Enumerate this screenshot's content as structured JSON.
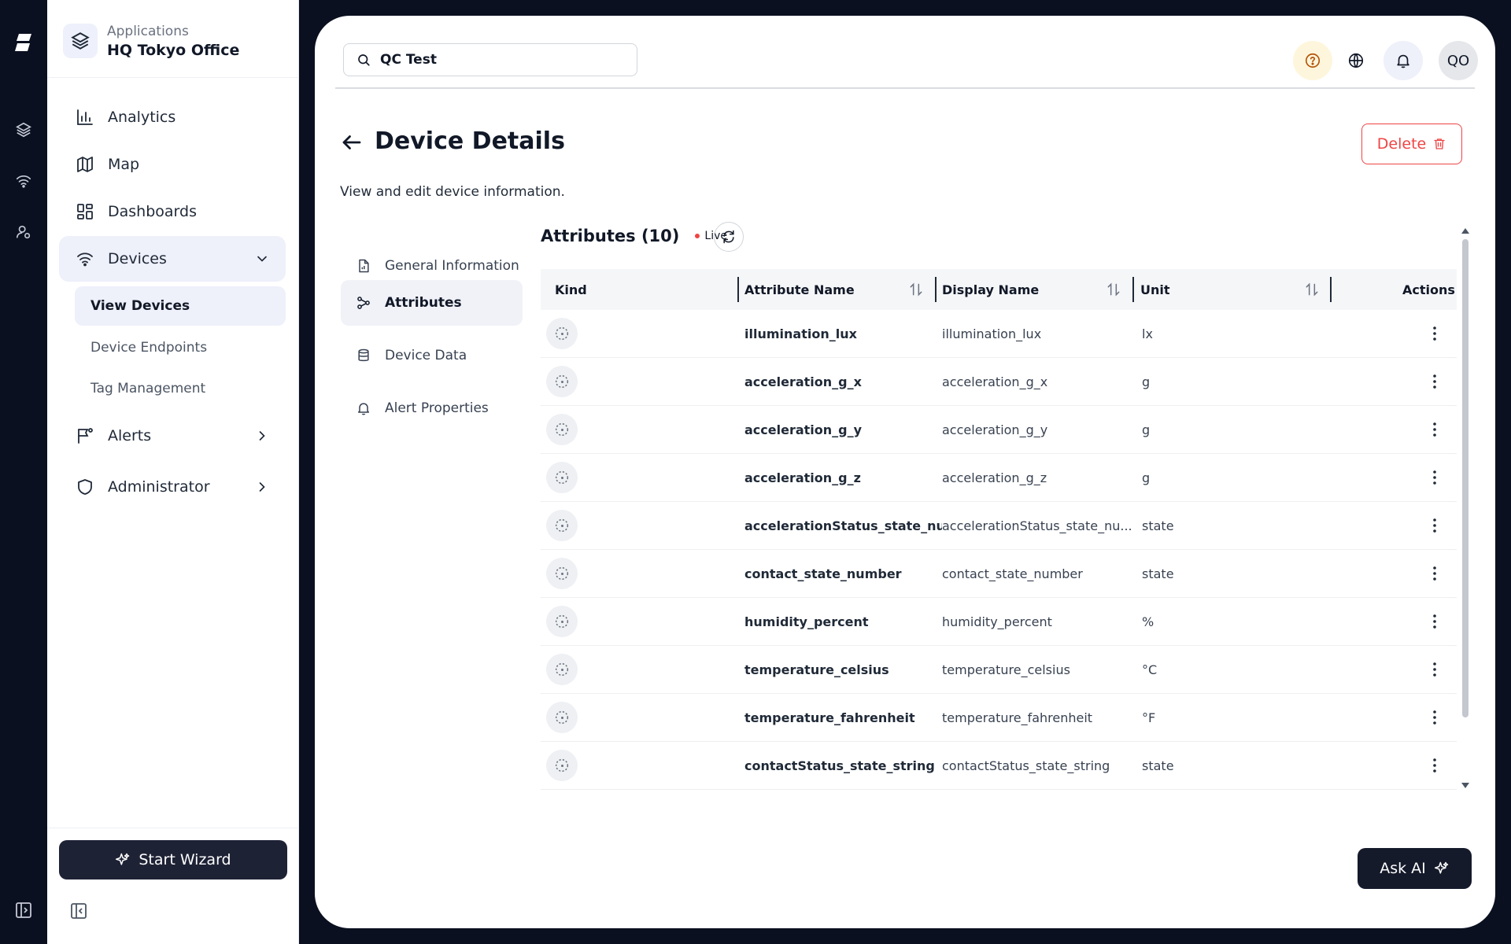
{
  "app": {
    "section_label": "Applications",
    "name": "HQ Tokyo Office"
  },
  "sidebar": {
    "items": [
      {
        "label": "Analytics",
        "icon": "bar-chart-icon"
      },
      {
        "label": "Map",
        "icon": "map-icon"
      },
      {
        "label": "Dashboards",
        "icon": "dashboard-grid-icon"
      },
      {
        "label": "Devices",
        "icon": "wifi-icon",
        "expanded": true
      },
      {
        "label": "Alerts",
        "icon": "alert-flag-icon"
      },
      {
        "label": "Administrator",
        "icon": "shield-icon"
      }
    ],
    "device_subitems": [
      {
        "label": "View Devices",
        "active": true
      },
      {
        "label": "Device Endpoints"
      },
      {
        "label": "Tag Management"
      }
    ],
    "wizard_label": "Start Wizard"
  },
  "header": {
    "search_value": "QC Test",
    "avatar_initials": "QO"
  },
  "page": {
    "title": "Device Details",
    "subtitle": "View and edit device information.",
    "delete_label": "Delete"
  },
  "tabs": [
    {
      "label": "General Information",
      "icon": "document-chart-icon"
    },
    {
      "label": "Attributes",
      "icon": "attributes-icon",
      "active": true
    },
    {
      "label": "Device Data",
      "icon": "database-icon"
    },
    {
      "label": "Alert Properties",
      "icon": "bell-icon"
    }
  ],
  "attributes": {
    "title": "Attributes (10)",
    "live_label": "Live",
    "columns": {
      "kind": "Kind",
      "attribute_name": "Attribute Name",
      "display_name": "Display Name",
      "unit": "Unit",
      "actions": "Actions"
    },
    "rows": [
      {
        "name": "illumination_lux",
        "display": "illumination_lux",
        "unit": "lx"
      },
      {
        "name": "acceleration_g_x",
        "display": "acceleration_g_x",
        "unit": "g"
      },
      {
        "name": "acceleration_g_y",
        "display": "acceleration_g_y",
        "unit": "g"
      },
      {
        "name": "acceleration_g_z",
        "display": "acceleration_g_z",
        "unit": "g"
      },
      {
        "name": "accelerationStatus_state_numb",
        "display": "accelerationStatus_state_nu...",
        "unit": "state"
      },
      {
        "name": "contact_state_number",
        "display": "contact_state_number",
        "unit": "state"
      },
      {
        "name": "humidity_percent",
        "display": "humidity_percent",
        "unit": "%"
      },
      {
        "name": "temperature_celsius",
        "display": "temperature_celsius",
        "unit": "°C"
      },
      {
        "name": "temperature_fahrenheit",
        "display": "temperature_fahrenheit",
        "unit": "°F"
      },
      {
        "name": "contactStatus_state_string",
        "display": "contactStatus_state_string",
        "unit": "state"
      }
    ]
  },
  "ask_ai_label": "Ask AI",
  "colors": {
    "rail_bg": "#0b1020",
    "active_bg": "#eef0fa",
    "danger": "#ef4444",
    "dark_button": "#1e2235",
    "help_bg": "#fef6dc",
    "bell_bg": "#eef0fa"
  }
}
